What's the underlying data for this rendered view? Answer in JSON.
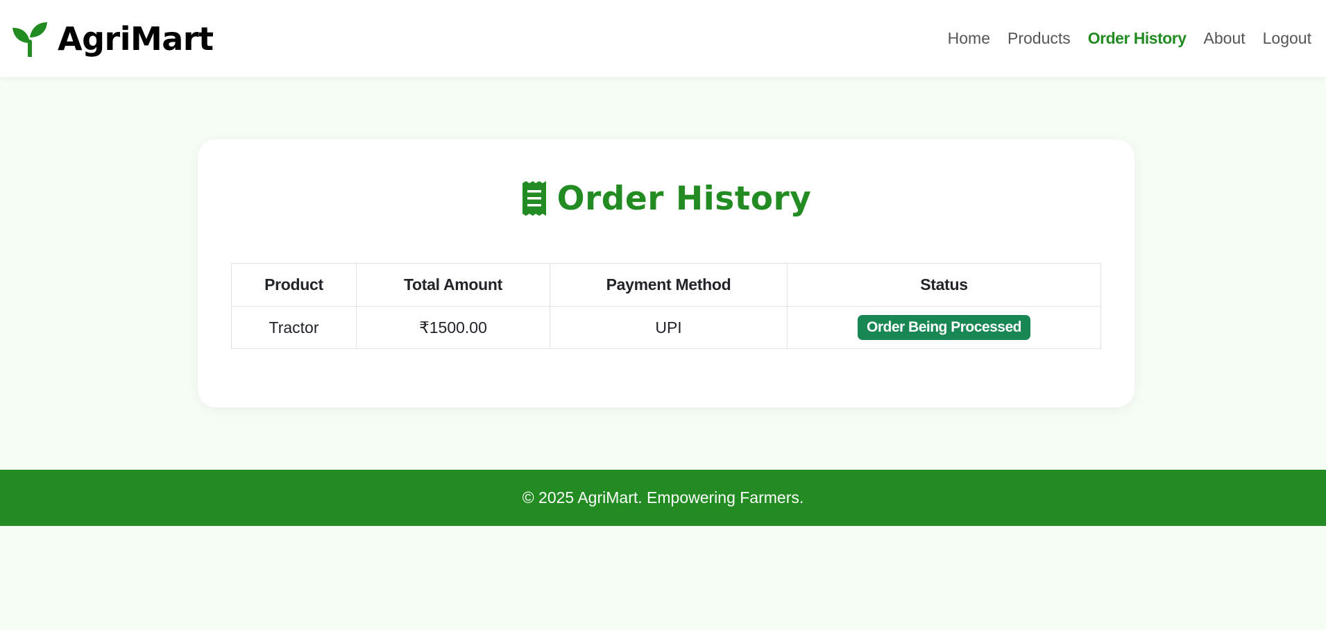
{
  "brand": {
    "name": "AgriMart",
    "icon": "sprout-icon"
  },
  "nav": {
    "items": [
      {
        "label": "Home",
        "active": false
      },
      {
        "label": "Products",
        "active": false
      },
      {
        "label": "Order History",
        "active": true
      },
      {
        "label": "About",
        "active": false
      },
      {
        "label": "Logout",
        "active": false
      }
    ]
  },
  "page": {
    "title": "Order History",
    "title_icon": "receipt-icon"
  },
  "table": {
    "headers": [
      "Product",
      "Total Amount",
      "Payment Method",
      "Status"
    ],
    "rows": [
      {
        "product": "Tractor",
        "total": "₹1500.00",
        "payment": "UPI",
        "status": "Order Being Processed"
      }
    ]
  },
  "footer": {
    "text": "© 2025 AgriMart. Empowering Farmers."
  },
  "colors": {
    "brand_green": "#228b22",
    "status_green": "#198754",
    "page_bg": "#f5fdf5"
  }
}
